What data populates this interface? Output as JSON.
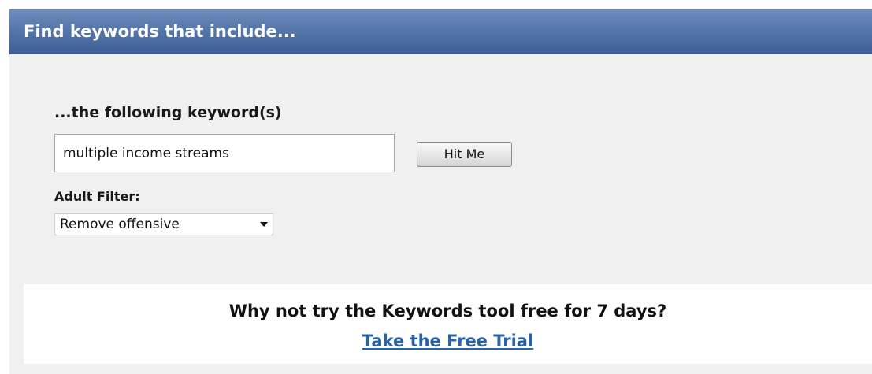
{
  "panel": {
    "title": "Find keywords that include...",
    "header_color": "#4f6fa6"
  },
  "search": {
    "heading": "...the following keyword(s)",
    "keyword_value": "multiple income streams",
    "submit_label": "Hit Me"
  },
  "filter": {
    "label": "Adult Filter:",
    "selected": "Remove offensive",
    "icon": "chevron-down-icon"
  },
  "promo": {
    "text": "Why not try the Keywords tool free for 7 days?",
    "link_label": "Take the Free Trial",
    "link_color": "#2a62a6"
  }
}
